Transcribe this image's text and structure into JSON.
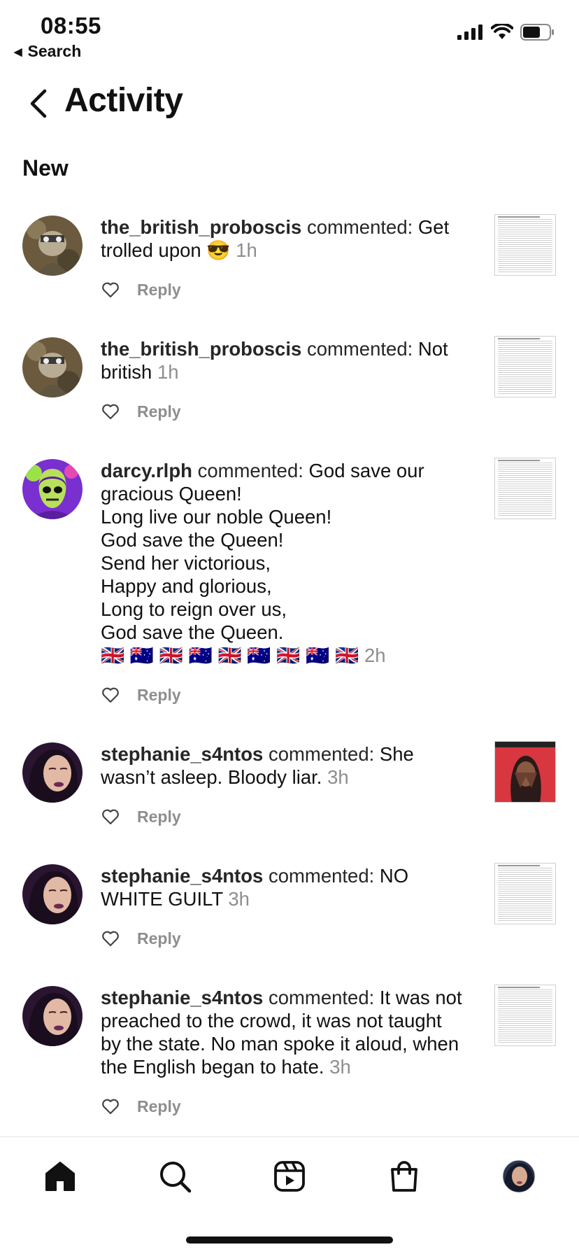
{
  "status_bar": {
    "time": "08:55",
    "back_app": "Search",
    "signal_icon": "cellular-signal-icon",
    "wifi_icon": "wifi-icon",
    "battery_icon": "battery-icon"
  },
  "header": {
    "title": "Activity",
    "back_icon": "chevron-left-icon"
  },
  "section": {
    "title": "New"
  },
  "notifications": [
    {
      "username": "the_british_proboscis",
      "verb": "commented:",
      "text": "Get trolled upon 😎",
      "time": "1h",
      "reply_label": "Reply",
      "thumbnail": "document"
    },
    {
      "username": "the_british_proboscis",
      "verb": "commented:",
      "text": "Not british",
      "time": "1h",
      "reply_label": "Reply",
      "thumbnail": "document"
    },
    {
      "username": "darcy.rlph",
      "verb": "commented:",
      "text": "God save our gracious Queen!\nLong live our noble Queen!\nGod save the Queen!\nSend her victorious,\nHappy and glorious,\nLong to reign over us,\nGod save the Queen.\n🇬🇧 🇦🇺 🇬🇧 🇦🇺 🇬🇧 🇦🇺 🇬🇧 🇦🇺 🇬🇧",
      "time": "2h",
      "reply_label": "Reply",
      "thumbnail": "document"
    },
    {
      "username": "stephanie_s4ntos",
      "verb": "commented:",
      "text": "She wasn’t asleep. Bloody liar.",
      "time": "3h",
      "reply_label": "Reply",
      "thumbnail": "illustration"
    },
    {
      "username": "stephanie_s4ntos",
      "verb": "commented:",
      "text": "NO WHITE GUILT",
      "time": "3h",
      "reply_label": "Reply",
      "thumbnail": "document"
    },
    {
      "username": "stephanie_s4ntos",
      "verb": "commented:",
      "text": "It was not preached to the crowd, it was not taught by the state. No man spoke it aloud, when the English began to hate.",
      "time": "3h",
      "reply_label": "Reply",
      "thumbnail": "document"
    }
  ],
  "tab_bar": {
    "tabs": [
      "home-icon",
      "search-icon",
      "reels-icon",
      "shop-icon",
      "profile-avatar"
    ]
  },
  "colors": {
    "text": "#262626",
    "secondary": "#8e8e8e",
    "background": "#ffffff"
  }
}
